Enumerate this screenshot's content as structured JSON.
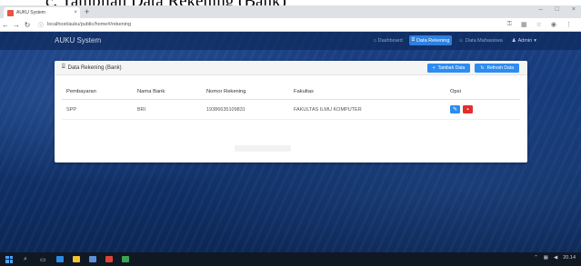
{
  "document_heading": "c.    Tampilan Data Rekening (Bank)",
  "browser": {
    "tab_title": "AUKU System",
    "tab_close": "×",
    "new_tab": "+",
    "url": "localhost/auku/public/home#/rekening",
    "window_controls": [
      "–",
      "□",
      "×"
    ]
  },
  "app": {
    "brand": "AUKU System",
    "nav": [
      {
        "label": "Dashboard",
        "icon": "home-icon",
        "active": false
      },
      {
        "label": "Data Rekening",
        "icon": "bank-icon",
        "active": true
      },
      {
        "label": "Data Mahasiswa",
        "icon": "users-icon",
        "active": false
      },
      {
        "label": "Admin",
        "icon": "user-icon",
        "active": false
      }
    ]
  },
  "panel": {
    "title": "Data Rekening (Bank)",
    "add_button": "Tambah Data",
    "refresh_button": "Refresh Data"
  },
  "table": {
    "columns": [
      "Pembayaran",
      "Nama Bank",
      "Nomor Rekening",
      "Fakultas",
      "Opsi"
    ],
    "rows": [
      {
        "pembayaran": "SPP",
        "nama_bank": "BRI",
        "nomor_rekening": "19386635109831",
        "fakultas": "FAKULTAS ILMU KOMPUTER"
      }
    ]
  },
  "taskbar": {
    "time": "20.14"
  },
  "colors": {
    "primary": "#2d8cf0",
    "danger": "#e0302c",
    "nav_active": "#2d7fe0",
    "background": "#163a79"
  }
}
